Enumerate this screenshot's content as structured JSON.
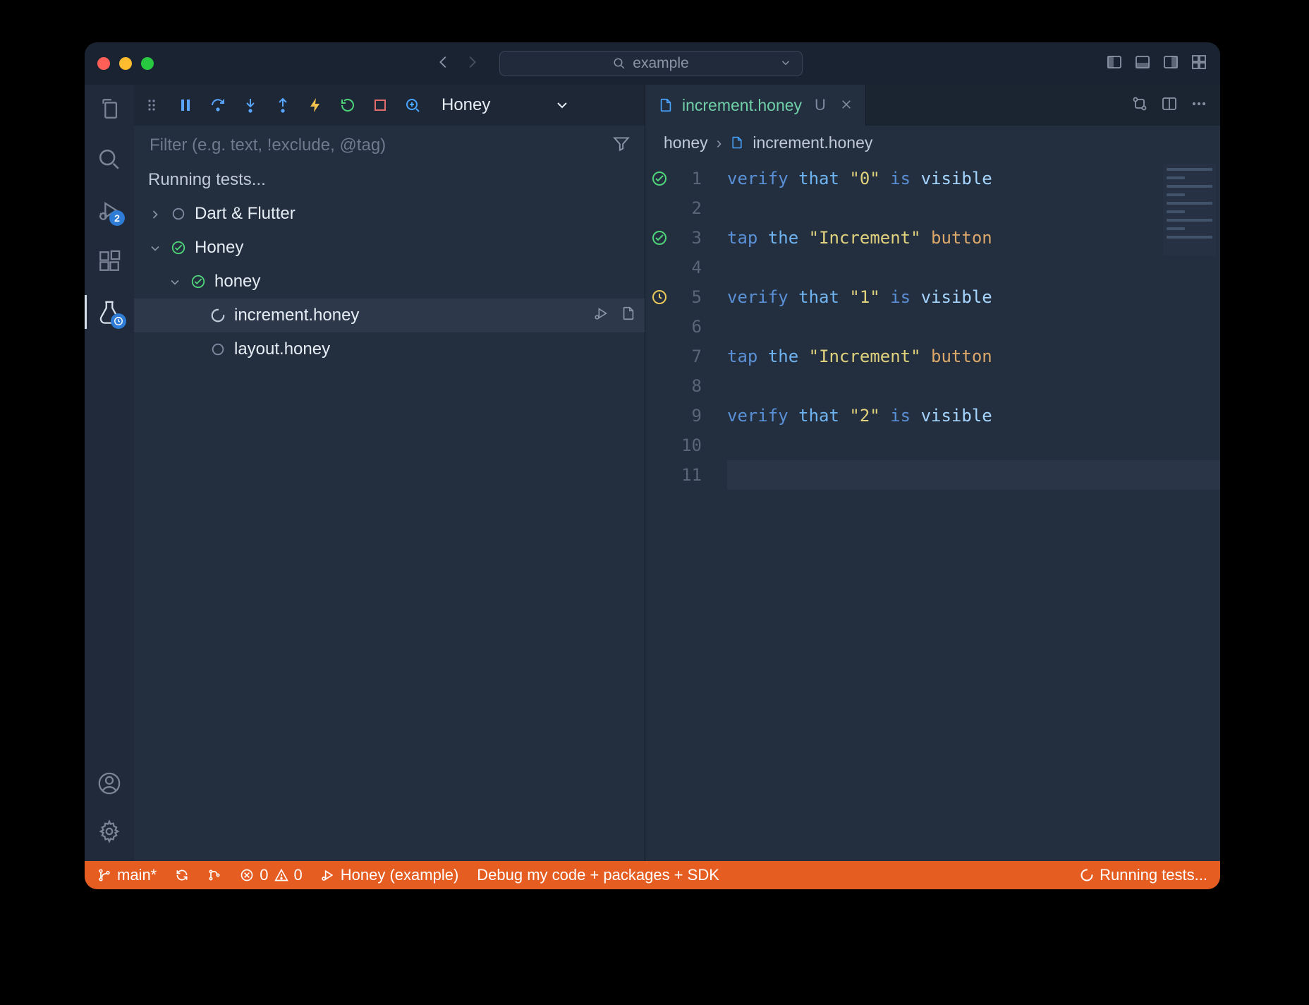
{
  "colors": {
    "status_bg": "#e55d21",
    "accent": "#4aa5ff"
  },
  "titlebar": {
    "search_text": "example"
  },
  "debug_toolbar": {
    "config_label": "Honey"
  },
  "test_panel": {
    "filter_placeholder": "Filter (e.g. text, !exclude, @tag)",
    "status_text": "Running tests...",
    "tree": [
      {
        "depth": 0,
        "expand": "collapsed",
        "status": "none",
        "label": "Dart & Flutter"
      },
      {
        "depth": 0,
        "expand": "expanded",
        "status": "pass",
        "label": "Honey"
      },
      {
        "depth": 1,
        "expand": "expanded",
        "status": "pass",
        "label": "honey"
      },
      {
        "depth": 2,
        "expand": "leaf",
        "status": "running",
        "label": "increment.honey",
        "selected": true,
        "actions": true
      },
      {
        "depth": 2,
        "expand": "leaf",
        "status": "none",
        "label": "layout.honey"
      }
    ]
  },
  "activity": {
    "run_debug_badge": "2"
  },
  "editor": {
    "tab": {
      "filename": "increment.honey",
      "modified_marker": "U"
    },
    "breadcrumbs": [
      "honey",
      "increment.honey"
    ],
    "glyphs": [
      "pass",
      "",
      "pass",
      "",
      "pending",
      "",
      "",
      "",
      "",
      "",
      ""
    ],
    "line_numbers": [
      "1",
      "2",
      "3",
      "4",
      "5",
      "6",
      "7",
      "8",
      "9",
      "10",
      "11"
    ],
    "lines": [
      [
        {
          "t": "verify",
          "c": "kw"
        },
        {
          "t": " "
        },
        {
          "t": "that",
          "c": "id"
        },
        {
          "t": " "
        },
        {
          "t": "\"0\"",
          "c": "str"
        },
        {
          "t": " "
        },
        {
          "t": "is",
          "c": "kw"
        },
        {
          "t": " "
        },
        {
          "t": "visible",
          "c": "prop"
        }
      ],
      [],
      [
        {
          "t": "tap",
          "c": "kw"
        },
        {
          "t": " "
        },
        {
          "t": "the",
          "c": "id"
        },
        {
          "t": " "
        },
        {
          "t": "\"Increment\"",
          "c": "str"
        },
        {
          "t": " "
        },
        {
          "t": "button",
          "c": "op"
        }
      ],
      [],
      [
        {
          "t": "verify",
          "c": "kw"
        },
        {
          "t": " "
        },
        {
          "t": "that",
          "c": "id"
        },
        {
          "t": " "
        },
        {
          "t": "\"1\"",
          "c": "str"
        },
        {
          "t": " "
        },
        {
          "t": "is",
          "c": "kw"
        },
        {
          "t": " "
        },
        {
          "t": "visible",
          "c": "prop"
        }
      ],
      [],
      [
        {
          "t": "tap",
          "c": "kw"
        },
        {
          "t": " "
        },
        {
          "t": "the",
          "c": "id"
        },
        {
          "t": " "
        },
        {
          "t": "\"Increment\"",
          "c": "str"
        },
        {
          "t": " "
        },
        {
          "t": "button",
          "c": "op"
        }
      ],
      [],
      [
        {
          "t": "verify",
          "c": "kw"
        },
        {
          "t": " "
        },
        {
          "t": "that",
          "c": "id"
        },
        {
          "t": " "
        },
        {
          "t": "\"2\"",
          "c": "str"
        },
        {
          "t": " "
        },
        {
          "t": "is",
          "c": "kw"
        },
        {
          "t": " "
        },
        {
          "t": "visible",
          "c": "prop"
        }
      ],
      [],
      []
    ],
    "current_line_index": 10
  },
  "statusbar": {
    "branch": "main*",
    "errors": "0",
    "warnings": "0",
    "launch": "Honey (example)",
    "debug_scope": "Debug my code + packages + SDK",
    "progress": "Running tests..."
  }
}
